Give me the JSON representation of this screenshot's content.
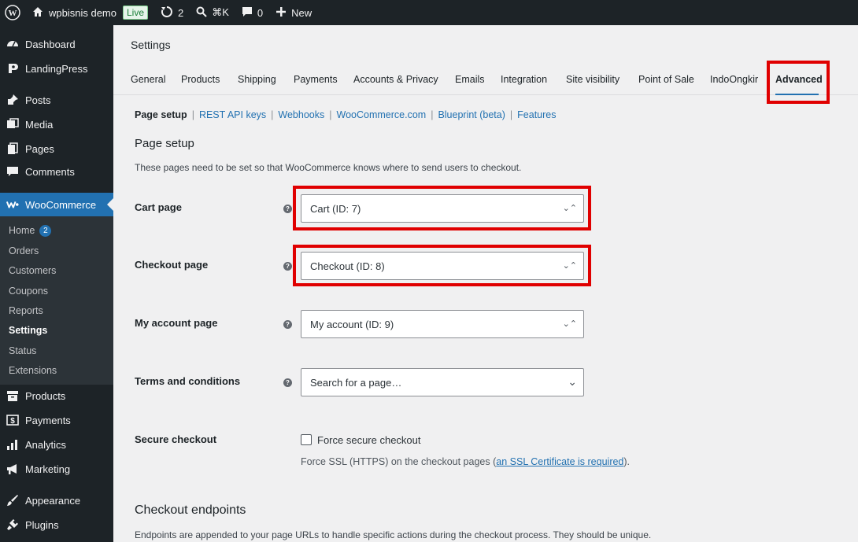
{
  "adminbar": {
    "site_name": "wpbisnis demo",
    "live_label": "Live",
    "updates_count": "2",
    "search_shortcut": "⌘K",
    "comments_count": "0",
    "new_label": "New"
  },
  "sidebar": {
    "items": [
      {
        "label": "Dashboard",
        "icon": "dashboard-icon"
      },
      {
        "label": "LandingPress",
        "icon": "landingpress-icon"
      },
      {
        "label": "Posts",
        "icon": "pin-icon"
      },
      {
        "label": "Media",
        "icon": "media-icon"
      },
      {
        "label": "Pages",
        "icon": "pages-icon"
      },
      {
        "label": "Comments",
        "icon": "comment-icon"
      },
      {
        "label": "WooCommerce",
        "icon": "woocommerce-icon"
      },
      {
        "label": "Products",
        "icon": "archive-icon"
      },
      {
        "label": "Payments",
        "icon": "payments-icon"
      },
      {
        "label": "Analytics",
        "icon": "bar-chart-icon"
      },
      {
        "label": "Marketing",
        "icon": "megaphone-icon"
      },
      {
        "label": "Appearance",
        "icon": "brush-icon"
      },
      {
        "label": "Plugins",
        "icon": "plugin-icon"
      }
    ],
    "submenu": [
      {
        "label": "Home",
        "badge": "2"
      },
      {
        "label": "Orders"
      },
      {
        "label": "Customers"
      },
      {
        "label": "Coupons"
      },
      {
        "label": "Reports"
      },
      {
        "label": "Settings"
      },
      {
        "label": "Status"
      },
      {
        "label": "Extensions"
      }
    ]
  },
  "header": {
    "title": "Settings",
    "tabs": [
      "General",
      "Products",
      "Shipping",
      "Payments",
      "Accounts & Privacy",
      "Emails",
      "Integration",
      "Site visibility",
      "Point of Sale",
      "IndoOngkir",
      "Advanced"
    ],
    "active_tab": "Advanced"
  },
  "subsub": [
    "Page setup",
    "REST API keys",
    "Webhooks",
    "WooCommerce.com",
    "Blueprint (beta)",
    "Features"
  ],
  "page_setup": {
    "title": "Page setup",
    "description": "These pages need to be set so that WooCommerce knows where to send users to checkout.",
    "fields": [
      {
        "label": "Cart page",
        "value": "Cart (ID: 7)",
        "arrow": "⌄⌃"
      },
      {
        "label": "Checkout page",
        "value": "Checkout (ID: 8)",
        "arrow": "⌄⌃"
      },
      {
        "label": "My account page",
        "value": "My account (ID: 9)",
        "arrow": "⌄⌃"
      },
      {
        "label": "Terms and conditions",
        "value": "Search for a page…",
        "arrow": "⌄"
      }
    ],
    "secure_checkout": {
      "label": "Secure checkout",
      "checkbox_label": "Force secure checkout",
      "desc_prefix": "Force SSL (HTTPS) on the checkout pages (",
      "desc_link": "an SSL Certificate is required",
      "desc_suffix": ")."
    }
  },
  "checkout_endpoints": {
    "title": "Checkout endpoints",
    "description": "Endpoints are appended to your page URLs to handle specific actions during the checkout process. They should be unique."
  },
  "colors": {
    "admin_dark": "#1d2327",
    "accent": "#2271b1",
    "highlight": "#e00000"
  }
}
